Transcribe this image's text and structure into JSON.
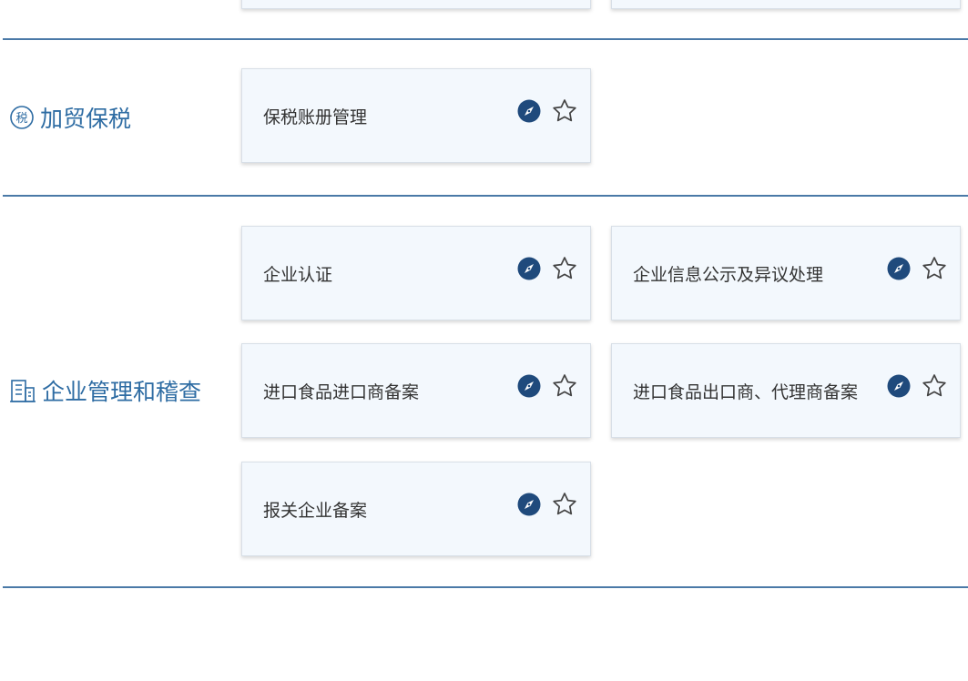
{
  "colors": {
    "accent": "#2e6ca3",
    "divider": "#4a79a7",
    "card_bg": "#f3f8fd",
    "compass": "#1f4a7c"
  },
  "sections": [
    {
      "title": "加贸保税",
      "icon": "tax-icon",
      "icon_text": "税",
      "cards": [
        {
          "label": "保税账册管理"
        }
      ]
    },
    {
      "title": "企业管理和稽查",
      "icon": "building-icon",
      "cards": [
        {
          "label": "企业认证"
        },
        {
          "label": "企业信息公示及异议处理"
        },
        {
          "label": "进口食品进口商备案"
        },
        {
          "label": "进口食品出口商、代理商备案"
        },
        {
          "label": "报关企业备案"
        }
      ]
    }
  ]
}
